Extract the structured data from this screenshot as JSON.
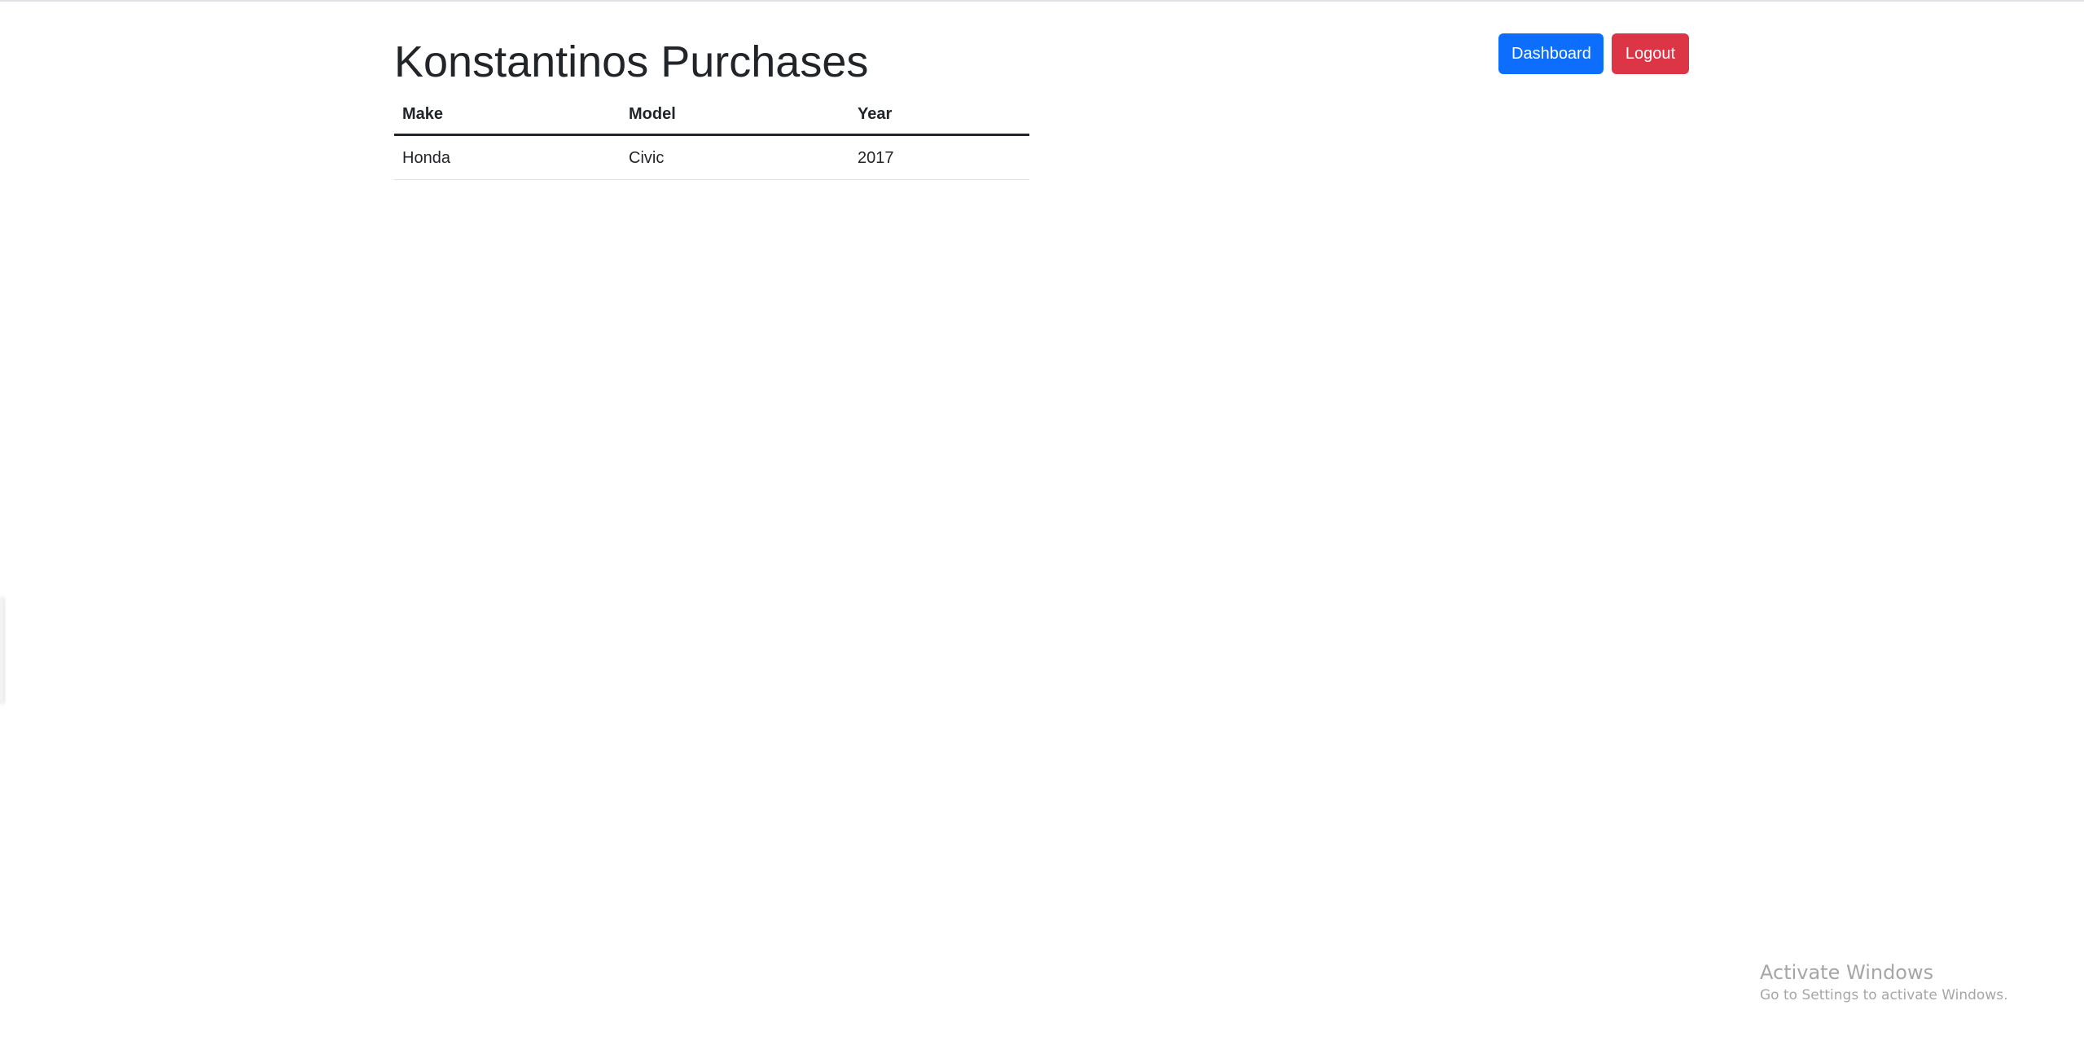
{
  "page": {
    "title": "Konstantinos Purchases"
  },
  "nav": {
    "dashboard_label": "Dashboard",
    "logout_label": "Logout"
  },
  "table": {
    "headers": [
      "Make",
      "Model",
      "Year"
    ],
    "rows": [
      [
        "Honda",
        "Civic",
        "2017"
      ]
    ]
  },
  "watermark": {
    "title": "Activate Windows",
    "subtitle": "Go to Settings to activate Windows."
  },
  "colors": {
    "primary": "#0d6efd",
    "danger": "#dc3545",
    "text": "#212529"
  }
}
